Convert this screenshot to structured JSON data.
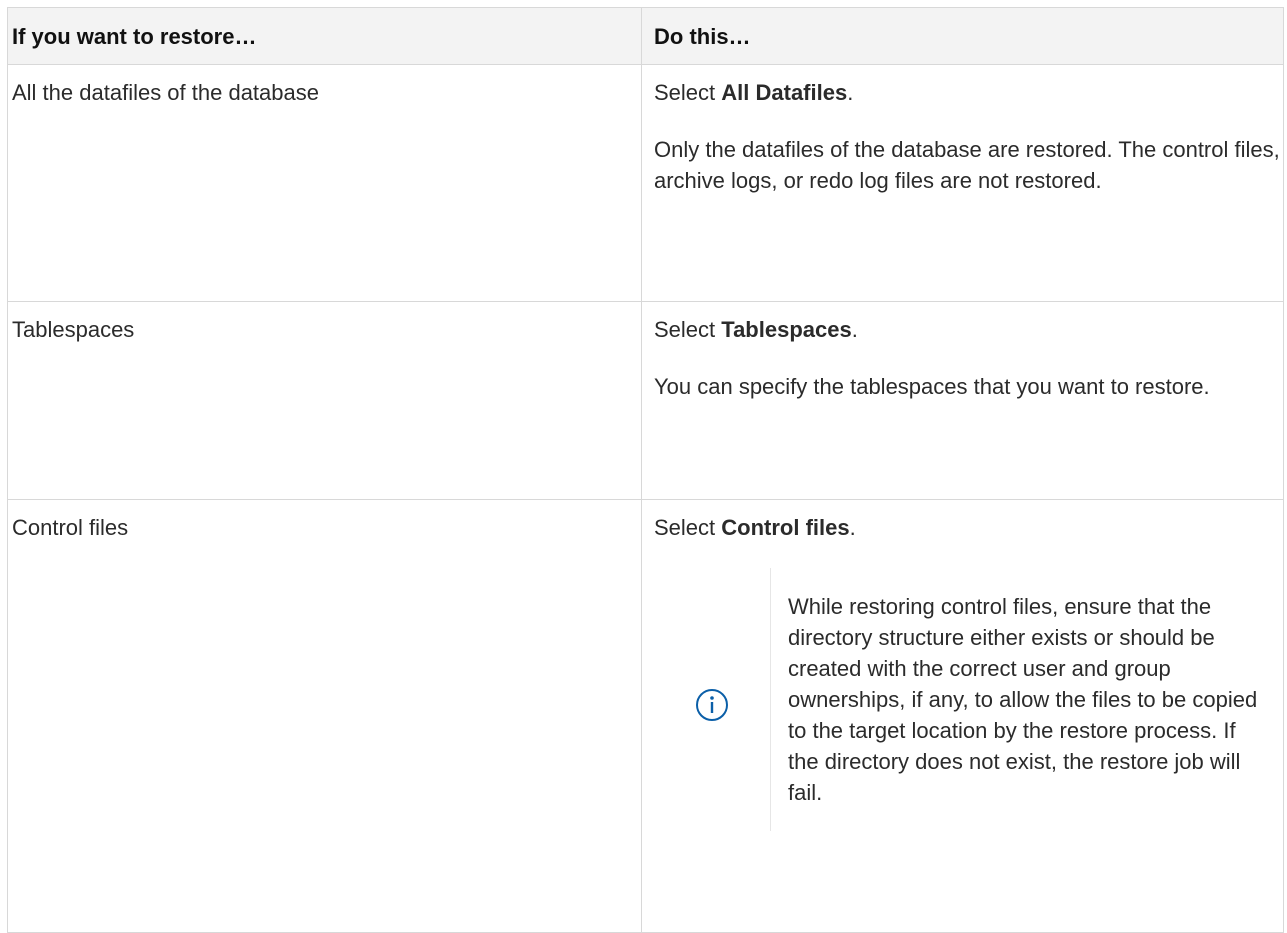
{
  "table": {
    "headers": [
      "If you want to restore…",
      "Do this…"
    ],
    "rows": [
      {
        "item": "All the datafiles of the database",
        "action_prefix": "Select ",
        "action_bold": "All Datafiles",
        "action_suffix": ".",
        "detail": "Only the datafiles of the database are restored. The control files, archive logs, or redo log files are not restored."
      },
      {
        "item": "Tablespaces",
        "action_prefix": "Select ",
        "action_bold": "Tablespaces",
        "action_suffix": ".",
        "detail": "You can specify the tablespaces that you want to restore."
      },
      {
        "item": "Control files",
        "action_prefix": "Select ",
        "action_bold": "Control files",
        "action_suffix": ".",
        "note_icon": "info-icon",
        "note": "While restoring control files, ensure that the directory structure either exists or should be created with the correct user and group ownerships, if any, to allow the files to be copied to the target location by the restore process. If the directory does not exist, the restore job will fail."
      }
    ]
  },
  "colors": {
    "icon": "#0b5fa8",
    "border": "#d8d8d8",
    "header_bg": "#f3f3f3"
  }
}
